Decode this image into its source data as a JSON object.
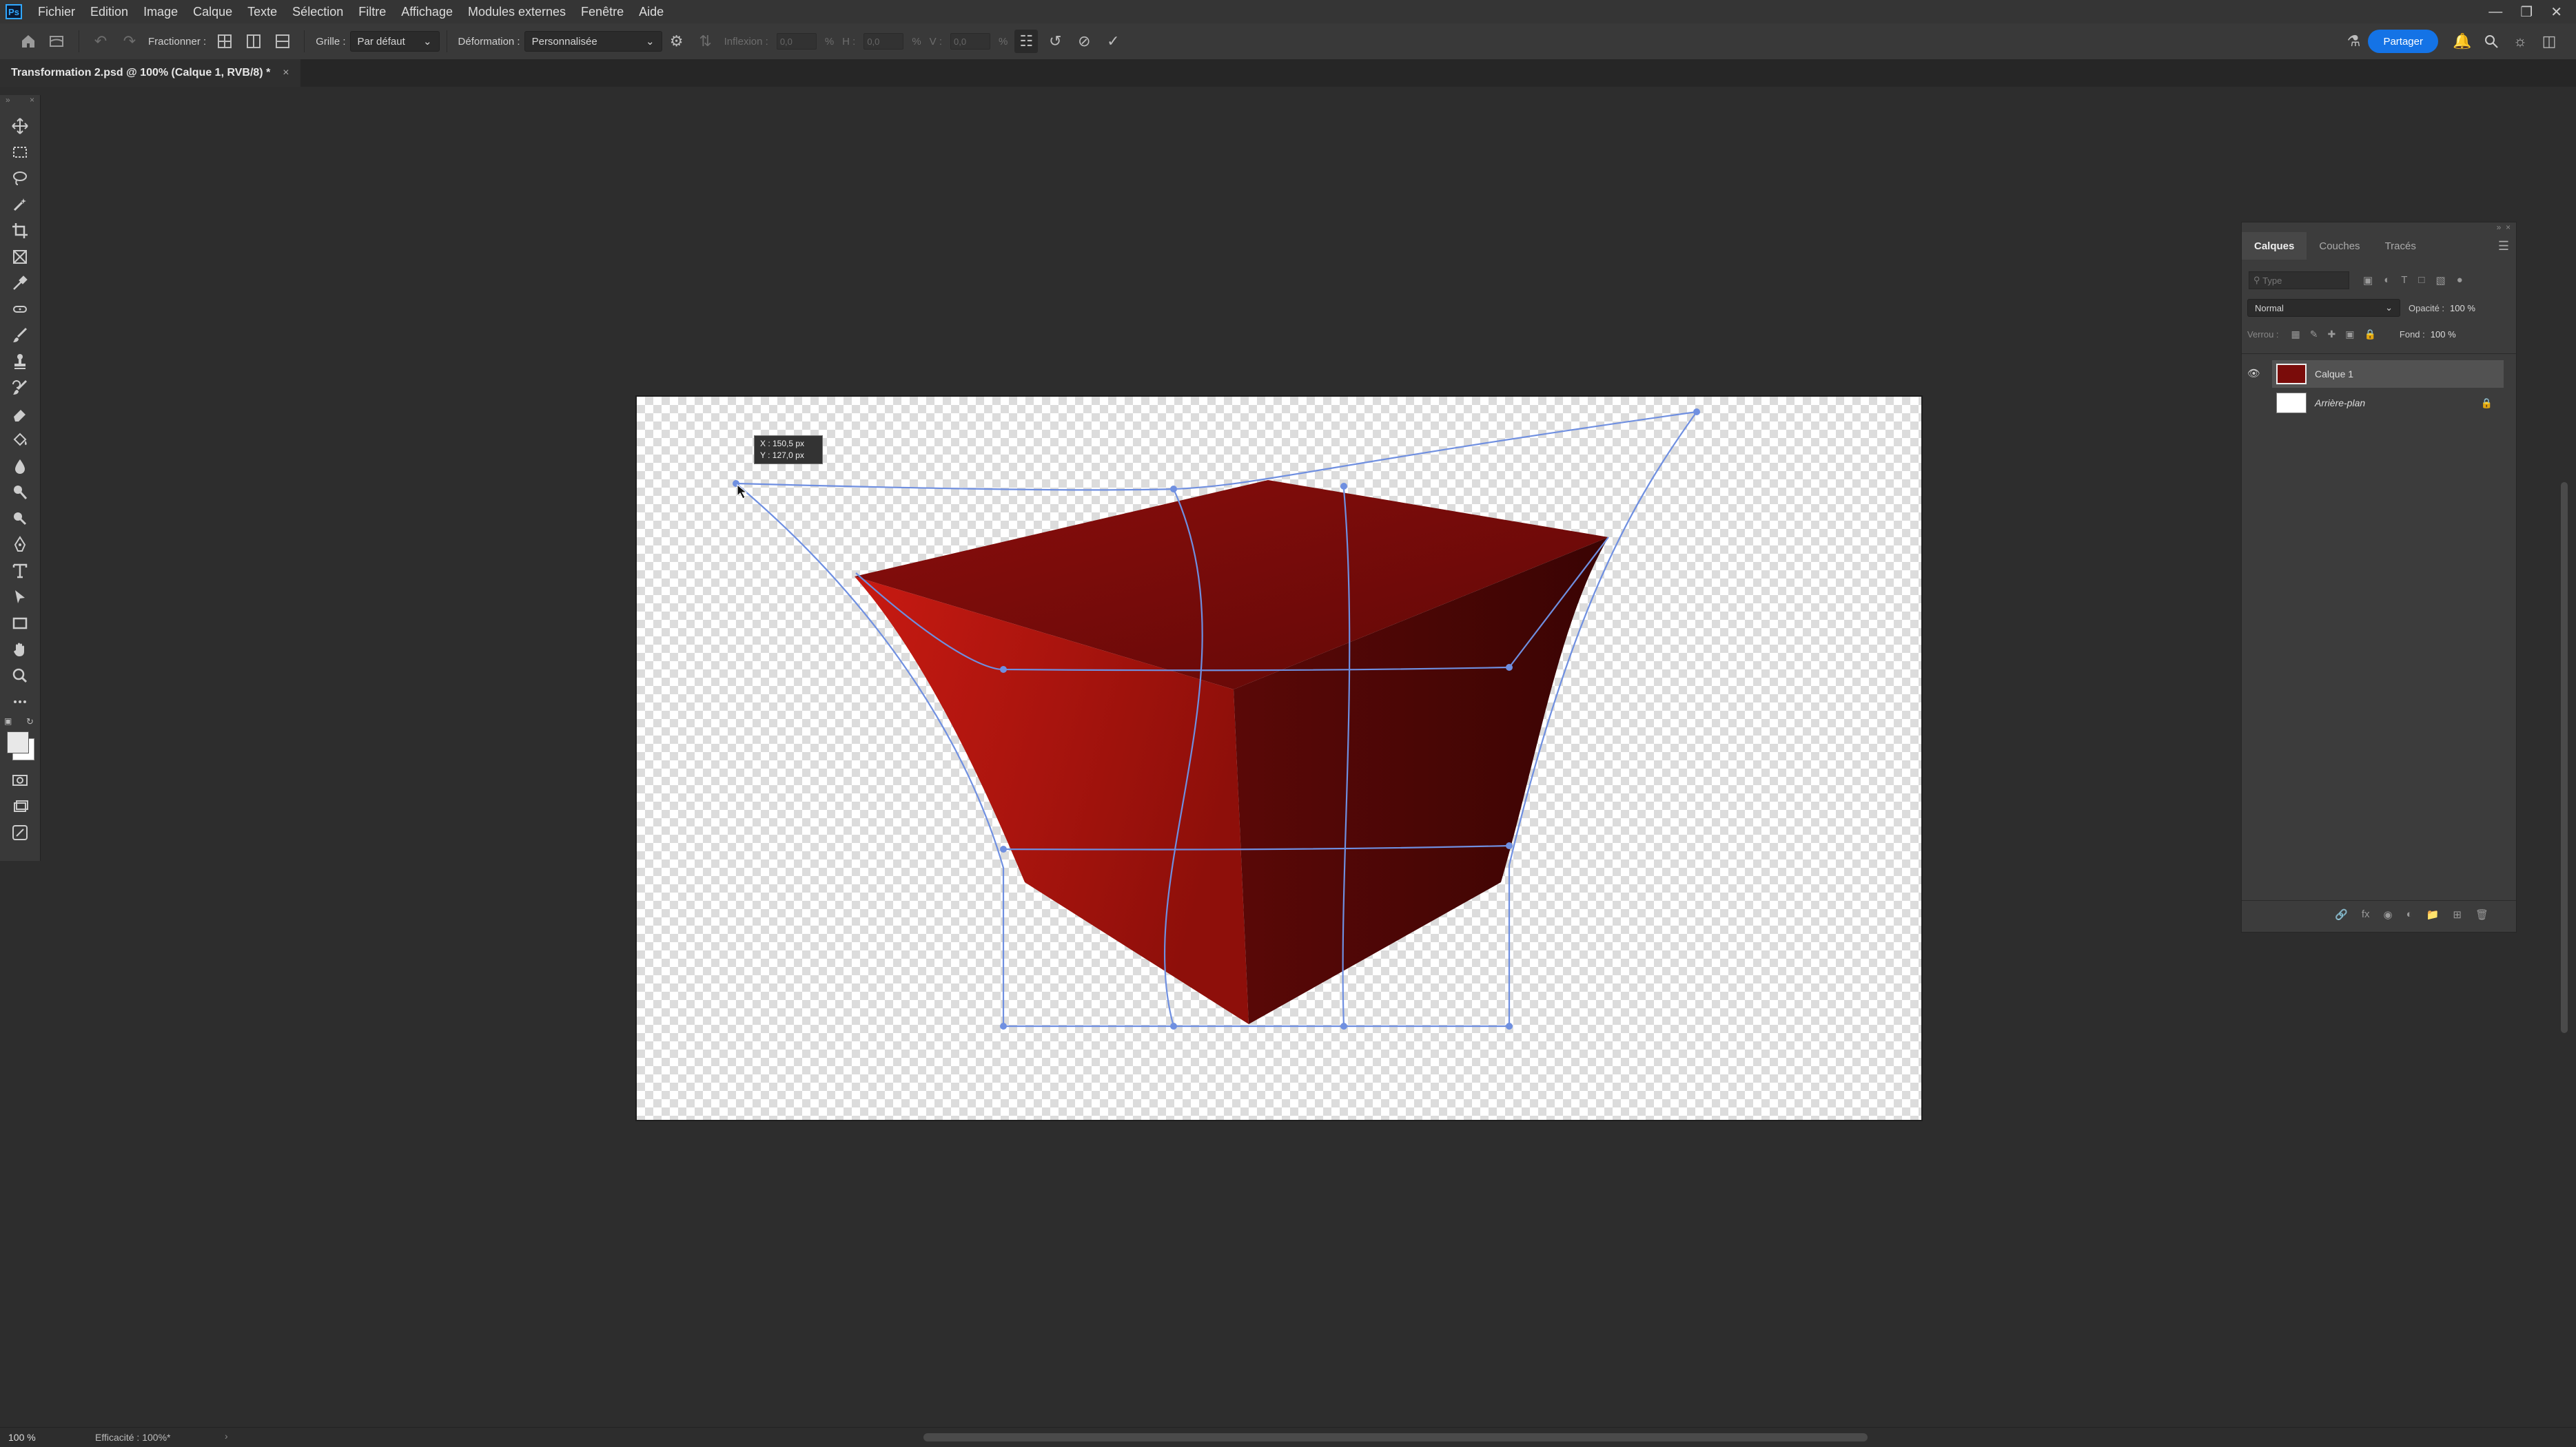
{
  "app": {
    "logo": "Ps",
    "accent": "#31a8ff"
  },
  "menu": [
    "Fichier",
    "Edition",
    "Image",
    "Calque",
    "Texte",
    "Sélection",
    "Filtre",
    "Affichage",
    "Modules externes",
    "Fenêtre",
    "Aide"
  ],
  "options": {
    "fractionner_label": "Fractionner :",
    "grille_label": "Grille :",
    "grille_value": "Par défaut",
    "deformation_label": "Déformation :",
    "deformation_value": "Personnalisée",
    "inflexion_label": "Inflexion :",
    "inflexion_value": "0,0",
    "h_label": "H :",
    "h_value": "0,0",
    "v_label": "V :",
    "v_value": "0,0",
    "percent": "%",
    "share_label": "Partager",
    "share_color": "#1473e6"
  },
  "document": {
    "tab_title": "Transformation 2.psd @ 100% (Calque 1, RVB/8) *",
    "close": "×"
  },
  "canvas": {
    "coord_x": "X : 150,5 px",
    "coord_y": "Y : 127,0 px",
    "cube_colors": {
      "top": "#7a0c0a",
      "left": "#b01810",
      "right": "#4e0605"
    },
    "warp_line_color": "#6f8fe0"
  },
  "layers_panel": {
    "tabs": [
      "Calques",
      "Couches",
      "Tracés"
    ],
    "filter_placeholder": "Type",
    "blend_mode": "Normal",
    "opacity_label": "Opacité :",
    "opacity_value": "100 %",
    "lock_label": "Verrou :",
    "fill_label": "Fond :",
    "fill_value": "100 %",
    "layers": [
      {
        "name": "Calque 1",
        "visible": true,
        "selected": true
      },
      {
        "name": "Arrière-plan",
        "visible": false,
        "locked": true
      }
    ]
  },
  "status": {
    "zoom": "100 %",
    "efficiency": "Efficacité : 100%*"
  }
}
